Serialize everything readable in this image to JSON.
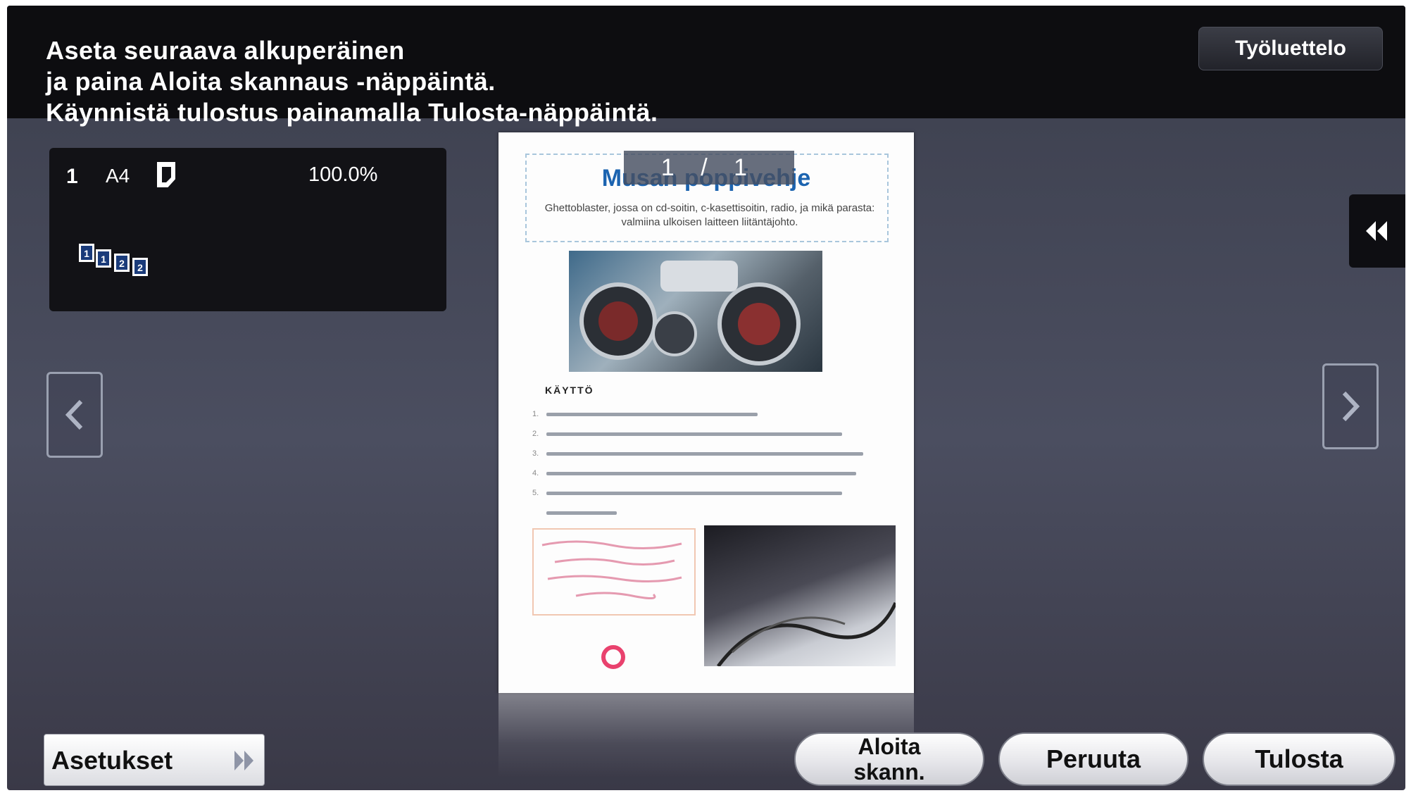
{
  "header": {
    "instructions": [
      "Aseta seuraava alkuperäinen",
      "ja paina Aloita skannaus -näppäintä.",
      "Käynnistä tulostus painamalla Tulosta-näppäintä."
    ],
    "job_list_label": "Työluettelo"
  },
  "info_panel": {
    "copies": "1",
    "paper_size": "A4",
    "zoom": "100.0%",
    "icons": [
      "page-icon",
      "collate-icon"
    ]
  },
  "preview": {
    "page_counter": "1 / 1",
    "doc_title": "Musan poppivehje",
    "doc_subtitle": "Ghettoblaster, jossa on cd-soitin, c-kasettisoitin, radio, ja mikä parasta: valmiina ulkoisen laitteen liitäntäjohto.",
    "section_heading": "KÄYTTÖ"
  },
  "navigation": {
    "left_icon": "chevron-left-icon",
    "right_icon": "chevron-right-icon",
    "collapse_icon": "double-chevron-left-icon"
  },
  "footer": {
    "settings_label": "Asetukset",
    "start_scan_line1": "Aloita",
    "start_scan_line2": "skann.",
    "cancel_label": "Peruuta",
    "print_label": "Tulosta"
  },
  "colors": {
    "header_bg": "#0d0d10",
    "screen_bg": "#45485a",
    "doc_title": "#1c64b0",
    "accent_logo": "#e9426e"
  }
}
